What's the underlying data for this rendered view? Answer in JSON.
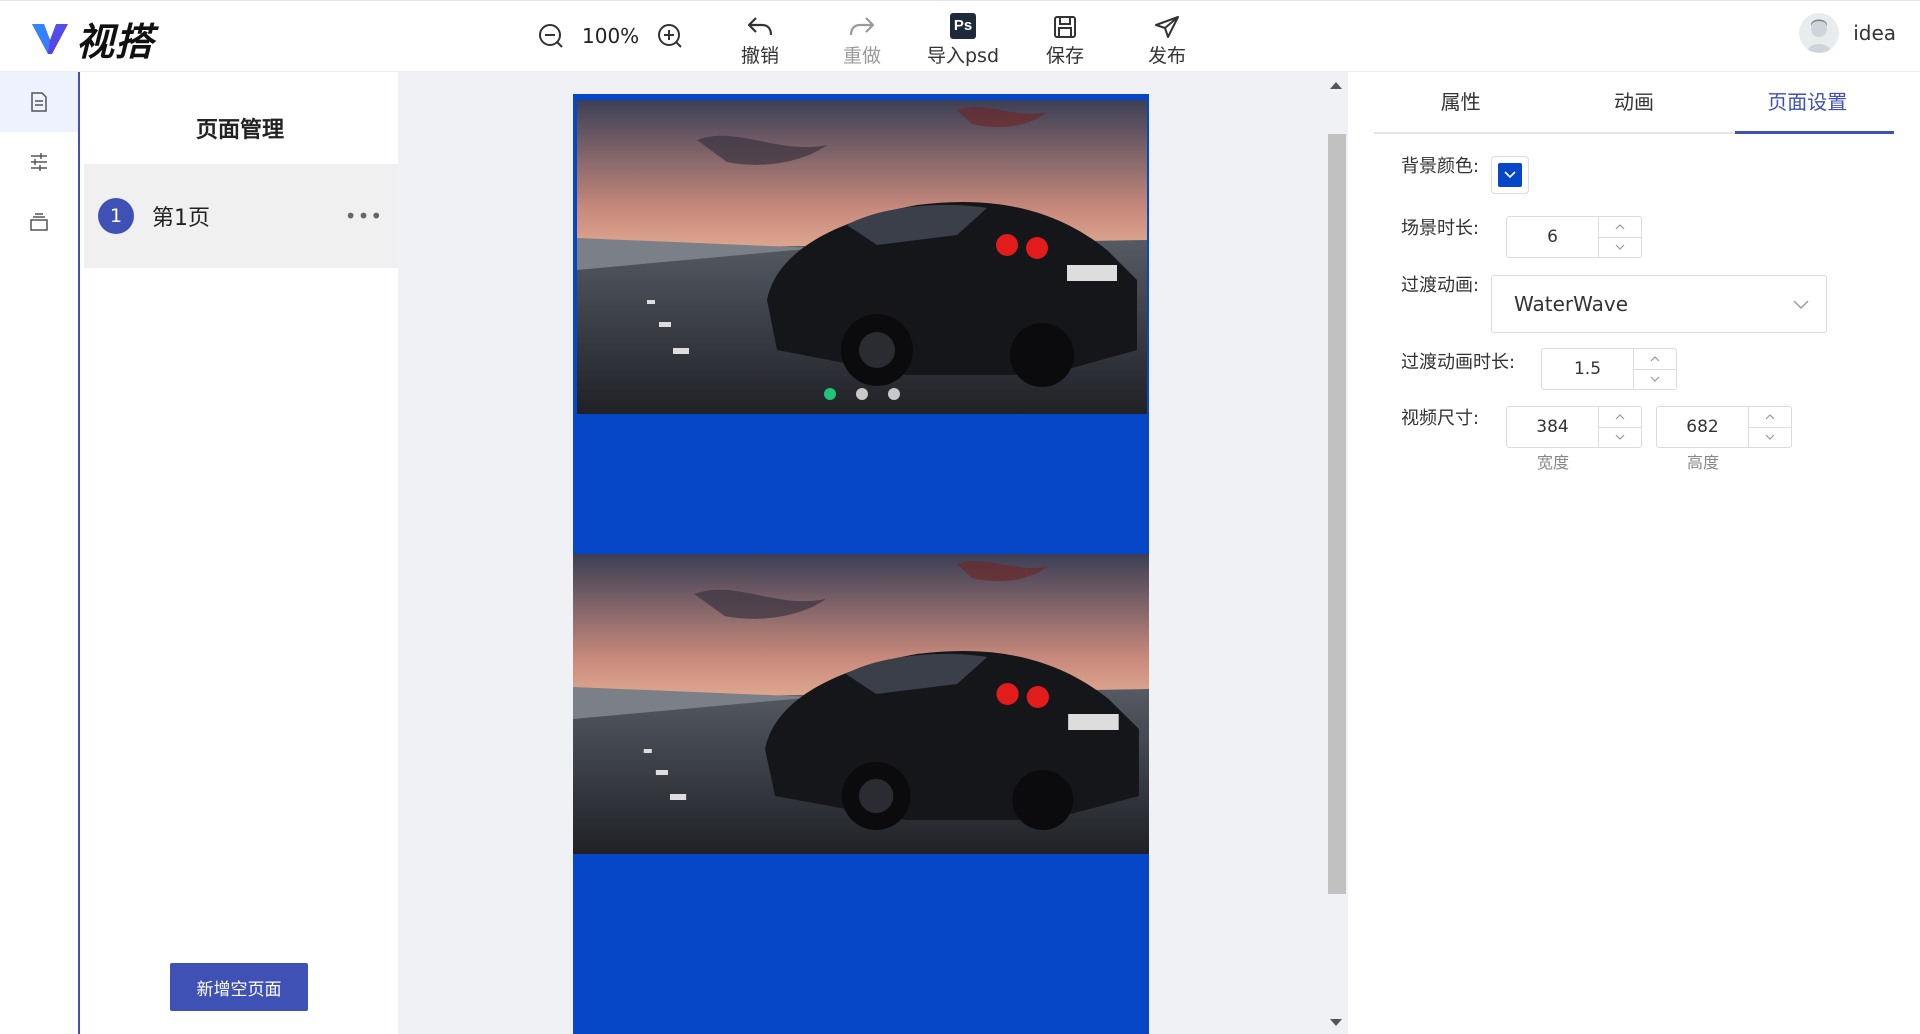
{
  "app": {
    "logo_text": "视搭",
    "brand_color": "#3f51b5"
  },
  "header": {
    "zoom": "100%",
    "tools": [
      {
        "label": "撤销",
        "icon": "undo-icon",
        "enabled": true
      },
      {
        "label": "重做",
        "icon": "redo-icon",
        "enabled": false
      },
      {
        "label": "导入psd",
        "icon": "ps-icon",
        "enabled": true,
        "badge": "Ps"
      },
      {
        "label": "保存",
        "icon": "save-icon",
        "enabled": true
      },
      {
        "label": "发布",
        "icon": "send-icon",
        "enabled": true
      }
    ],
    "user": {
      "name": "idea"
    }
  },
  "rail": {
    "items": [
      {
        "icon": "document-icon",
        "active": true
      },
      {
        "icon": "sliders-icon",
        "active": false
      },
      {
        "icon": "layers-icon",
        "active": false
      }
    ]
  },
  "pages": {
    "title": "页面管理",
    "items": [
      {
        "number": "1",
        "name": "第1页",
        "more": "•••"
      }
    ],
    "add_button": "新增空页面"
  },
  "canvas": {
    "background": "#0547c6",
    "carousel": {
      "dots": 3,
      "active_dot": 0,
      "active_color": "#1dc47a"
    }
  },
  "settings": {
    "tabs": [
      {
        "label": "属性"
      },
      {
        "label": "动画"
      },
      {
        "label": "页面设置",
        "active": true
      }
    ],
    "bg_color_label": "背景颜色:",
    "bg_color": "#0547c6",
    "duration_label": "场景时长:",
    "duration": "6",
    "transition_label": "过渡动画:",
    "transition": "WaterWave",
    "transition_duration_label": "过渡动画时长:",
    "transition_duration": "1.5",
    "video_size_label": "视频尺寸:",
    "width": "384",
    "height": "682",
    "width_label": "宽度",
    "height_label": "高度"
  }
}
